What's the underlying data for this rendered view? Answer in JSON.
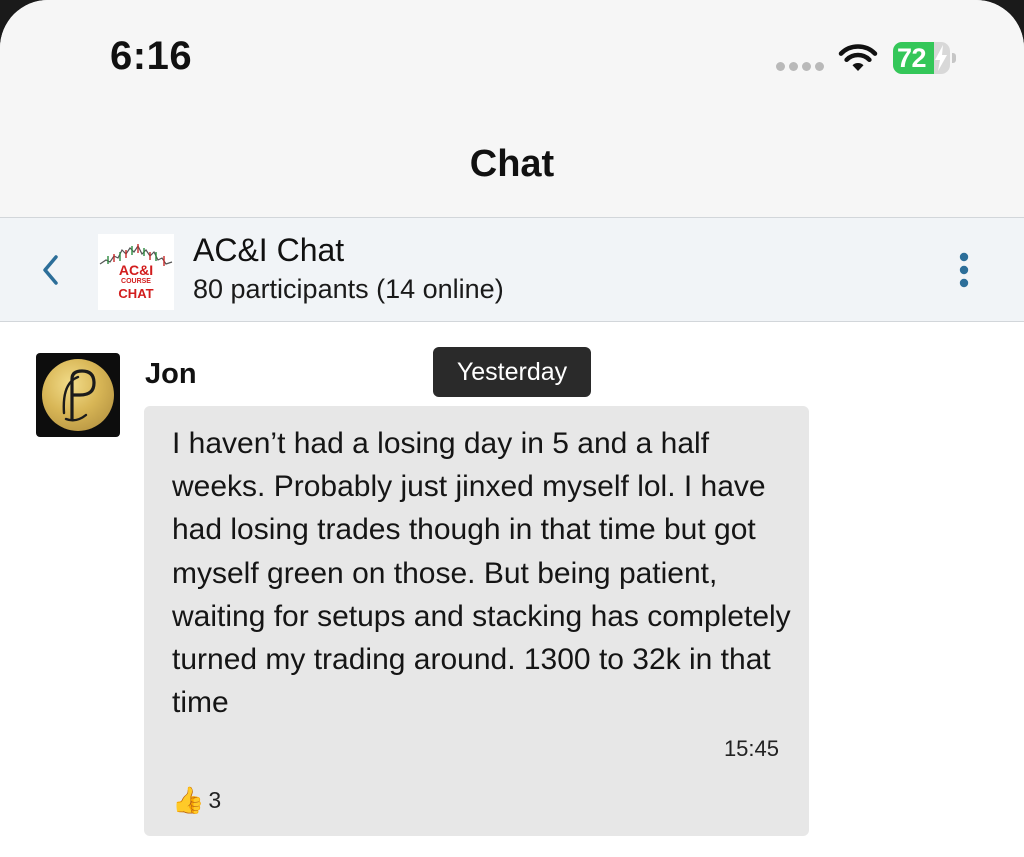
{
  "status_bar": {
    "time": "6:16",
    "battery_percent": "72",
    "battery_level": 0.72,
    "battery_color": "#34c759"
  },
  "nav": {
    "title": "Chat"
  },
  "chat_header": {
    "back_icon": "chevron-left-icon",
    "group_logo": {
      "line1": "AC&I",
      "line2": "COURSE",
      "line3": "CHAT"
    },
    "name": "AC&I Chat",
    "participants": "80 participants (14 online)",
    "accent_color": "#2c6e99"
  },
  "messages": {
    "date_separator": "Yesterday",
    "items": [
      {
        "sender": "Jon",
        "text": "I haven’t had a losing day in 5 and a half weeks. Probably just jinxed myself lol. I have had losing trades though in that time but got myself green on those. But being patient, waiting for setups and stacking has completely turned my trading around. 1300 to 32k in that time",
        "time": "15:45",
        "reaction": {
          "emoji": "👍",
          "count": "3"
        }
      }
    ]
  }
}
